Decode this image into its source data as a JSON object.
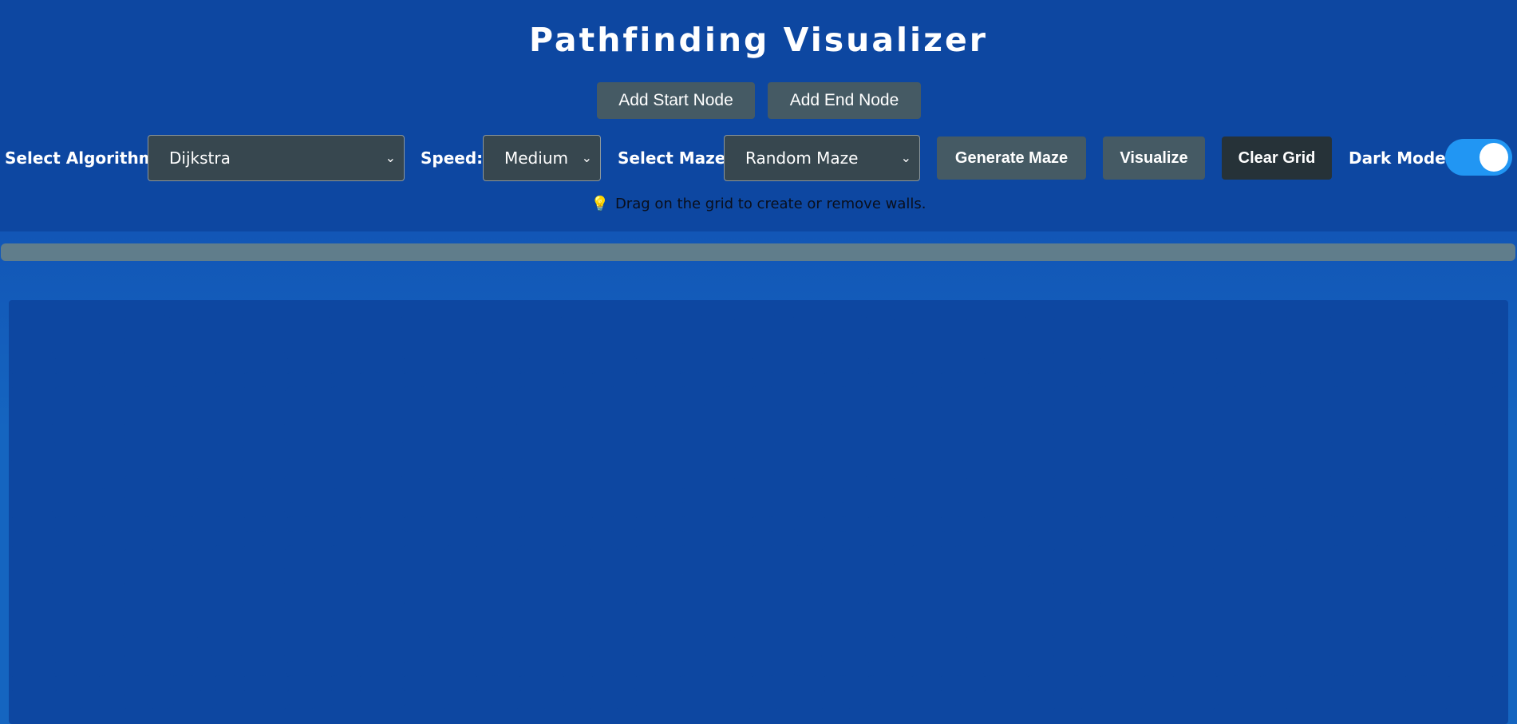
{
  "header": {
    "title": "Pathfinding Visualizer",
    "add_start_label": "Add Start Node",
    "add_end_label": "Add End Node"
  },
  "controls": {
    "algorithm_label": "Select Algorithm:",
    "algorithm_value": "Dijkstra",
    "speed_label": "Speed:",
    "speed_value": "Medium",
    "maze_label": "Select Maze:",
    "maze_value": "Random Maze",
    "generate_maze_label": "Generate Maze",
    "visualize_label": "Visualize",
    "clear_grid_label": "Clear Grid",
    "dark_mode_label": "Dark Mode:",
    "dark_mode_on": true
  },
  "hint": {
    "icon": "lightbulb-icon",
    "text": "Drag on the grid to create or remove walls."
  },
  "progress": {
    "value": 0
  },
  "colors": {
    "header_bg": "#0d47a1",
    "button_bg": "#455a64",
    "clear_button_bg": "#263238",
    "toggle_on": "#2196f3",
    "grid_bg": "#ffffff",
    "grid_mark": "#0d47a1"
  }
}
